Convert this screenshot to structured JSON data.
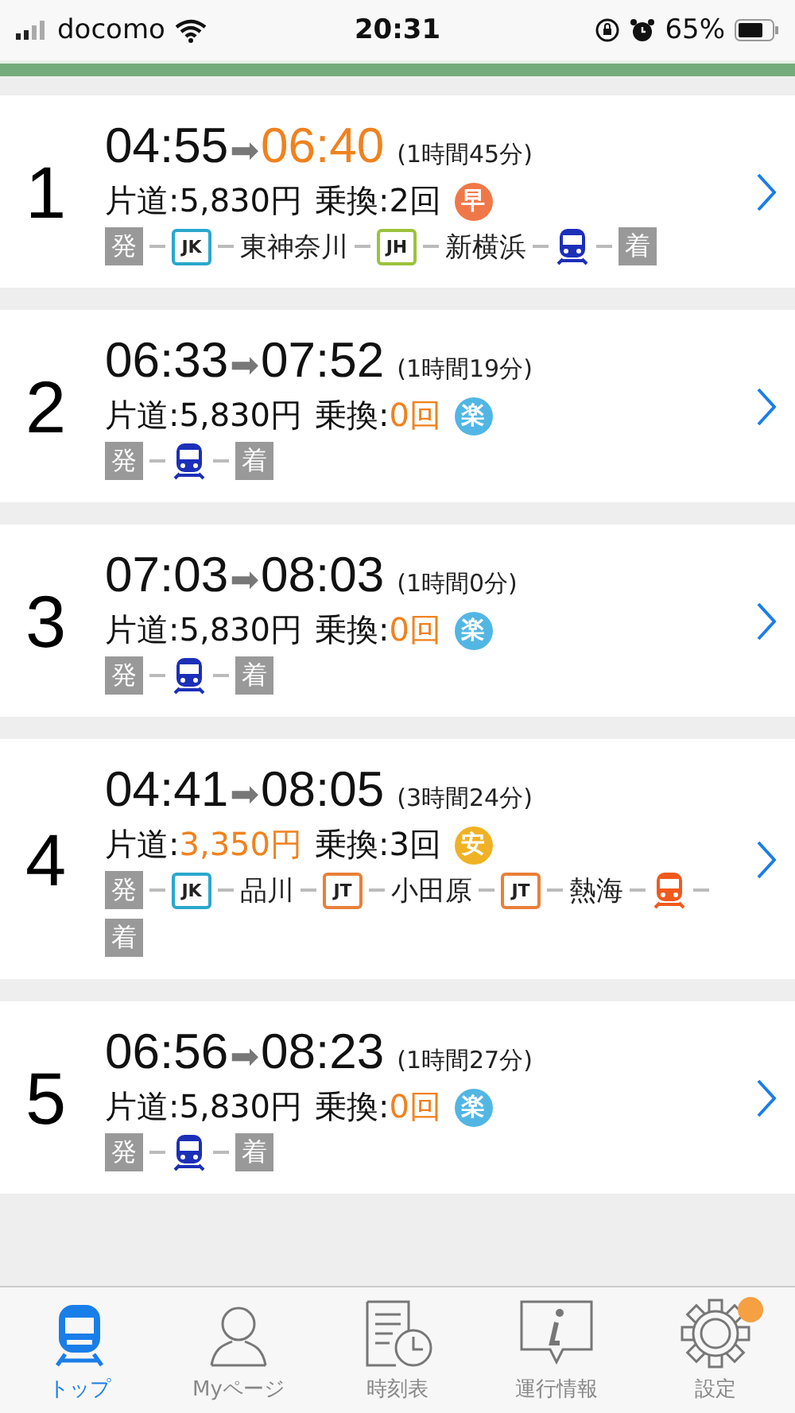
{
  "status_bar": {
    "carrier": "docomo",
    "time": "20:31",
    "battery": "65%"
  },
  "routes": [
    {
      "number": "1",
      "depart": "04:55",
      "arrow": "➡",
      "arrive": "06:40",
      "arrive_highlight": true,
      "duration": "(1時間45分)",
      "fare_label": "片道:",
      "fare": "5,830円",
      "fare_highlight": false,
      "transfer_label": "乗換:",
      "transfers": "2回",
      "transfers_highlight": false,
      "badge": {
        "text": "早",
        "color": "#f07848"
      },
      "segments": [
        {
          "kind": "terminal",
          "text": "発"
        },
        {
          "kind": "line",
          "text": "JK",
          "color": "#2aa8cc"
        },
        {
          "kind": "station",
          "text": "東神奈川"
        },
        {
          "kind": "line",
          "text": "JH",
          "color": "#9cc23c"
        },
        {
          "kind": "station",
          "text": "新横浜"
        },
        {
          "kind": "train",
          "color": "#1c2fb8"
        },
        {
          "kind": "terminal",
          "text": "着"
        }
      ]
    },
    {
      "number": "2",
      "depart": "06:33",
      "arrow": "➡",
      "arrive": "07:52",
      "arrive_highlight": false,
      "duration": "(1時間19分)",
      "fare_label": "片道:",
      "fare": "5,830円",
      "fare_highlight": false,
      "transfer_label": "乗換:",
      "transfers": "0回",
      "transfers_highlight": true,
      "badge": {
        "text": "楽",
        "color": "#52b6e4"
      },
      "segments": [
        {
          "kind": "terminal",
          "text": "発"
        },
        {
          "kind": "train",
          "color": "#1c2fb8"
        },
        {
          "kind": "terminal",
          "text": "着"
        }
      ]
    },
    {
      "number": "3",
      "depart": "07:03",
      "arrow": "➡",
      "arrive": "08:03",
      "arrive_highlight": false,
      "duration": "(1時間0分)",
      "fare_label": "片道:",
      "fare": "5,830円",
      "fare_highlight": false,
      "transfer_label": "乗換:",
      "transfers": "0回",
      "transfers_highlight": true,
      "badge": {
        "text": "楽",
        "color": "#52b6e4"
      },
      "segments": [
        {
          "kind": "terminal",
          "text": "発"
        },
        {
          "kind": "train",
          "color": "#1c2fb8"
        },
        {
          "kind": "terminal",
          "text": "着"
        }
      ]
    },
    {
      "number": "4",
      "depart": "04:41",
      "arrow": "➡",
      "arrive": "08:05",
      "arrive_highlight": false,
      "duration": "(3時間24分)",
      "fare_label": "片道:",
      "fare": "3,350円",
      "fare_highlight": true,
      "transfer_label": "乗換:",
      "transfers": "3回",
      "transfers_highlight": false,
      "badge": {
        "text": "安",
        "color": "#f0b224"
      },
      "segments": [
        {
          "kind": "terminal",
          "text": "発"
        },
        {
          "kind": "line",
          "text": "JK",
          "color": "#2aa8cc"
        },
        {
          "kind": "station",
          "text": "品川"
        },
        {
          "kind": "line",
          "text": "JT",
          "color": "#e8803a"
        },
        {
          "kind": "station",
          "text": "小田原"
        },
        {
          "kind": "line",
          "text": "JT",
          "color": "#e8803a"
        },
        {
          "kind": "station",
          "text": "熱海"
        },
        {
          "kind": "train",
          "color": "#f05a1c"
        },
        {
          "kind": "terminal",
          "text": "着"
        }
      ]
    },
    {
      "number": "5",
      "depart": "06:56",
      "arrow": "➡",
      "arrive": "08:23",
      "arrive_highlight": false,
      "duration": "(1時間27分)",
      "fare_label": "片道:",
      "fare": "5,830円",
      "fare_highlight": false,
      "transfer_label": "乗換:",
      "transfers": "0回",
      "transfers_highlight": true,
      "badge": {
        "text": "楽",
        "color": "#52b6e4"
      },
      "segments": [
        {
          "kind": "terminal",
          "text": "発"
        },
        {
          "kind": "train",
          "color": "#1c2fb8"
        },
        {
          "kind": "terminal",
          "text": "着"
        }
      ]
    }
  ],
  "tabs": [
    {
      "kind": "train",
      "label": "トップ",
      "selected": true,
      "notification": false
    },
    {
      "kind": "person",
      "label": "Myページ",
      "selected": false,
      "notification": false
    },
    {
      "kind": "timetable",
      "label": "時刻表",
      "selected": false,
      "notification": false
    },
    {
      "kind": "info",
      "label": "運行情報",
      "selected": false,
      "notification": false
    },
    {
      "kind": "gear",
      "label": "設定",
      "selected": false,
      "notification": true
    }
  ]
}
